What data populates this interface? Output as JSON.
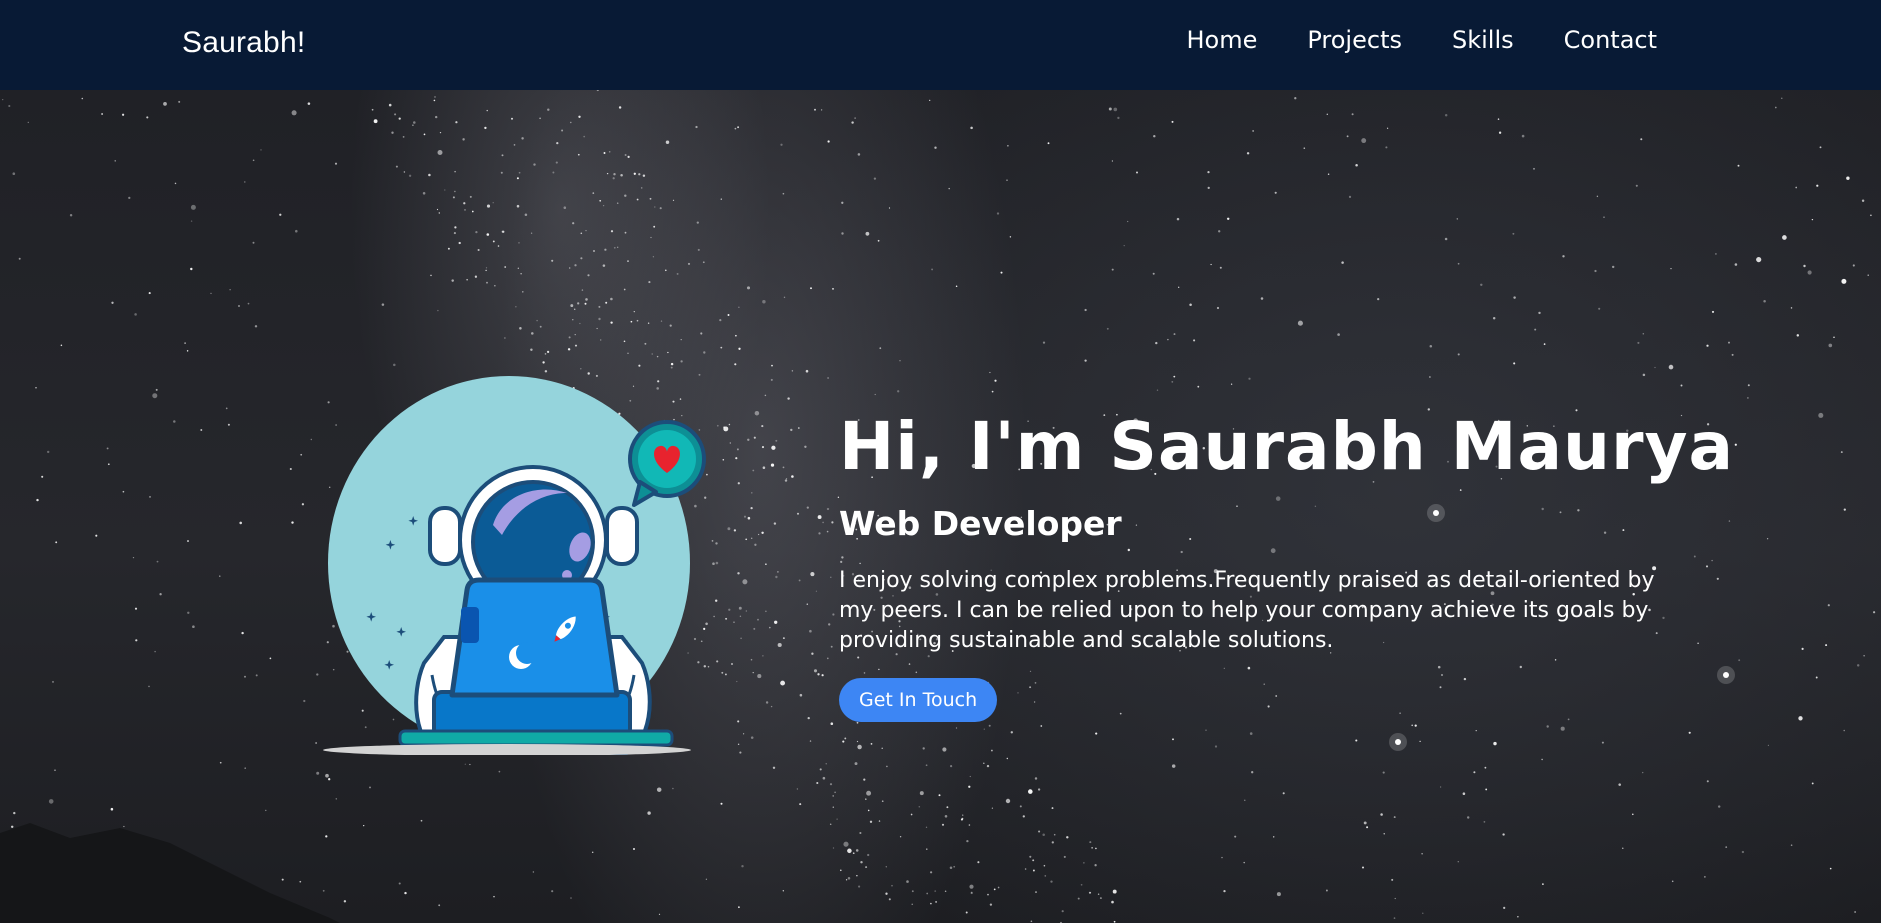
{
  "navbar": {
    "brand": "Saurabh!",
    "links": [
      {
        "label": "Home"
      },
      {
        "label": "Projects"
      },
      {
        "label": "Skills"
      },
      {
        "label": "Contact"
      }
    ]
  },
  "hero": {
    "title": "Hi, I'm Saurabh Maurya",
    "subtitle": "Web Developer",
    "description": "I enjoy solving complex problems.Frequently praised as detail-oriented by my peers. I can be relied upon to help your company achieve its goals by providing sustainable and scalable solutions.",
    "cta_label": "Get In Touch",
    "illustration": "astronaut-with-laptop-illustration"
  },
  "colors": {
    "navbar_bg": "#081a35",
    "button_bg": "#3d86f4",
    "text": "#ffffff",
    "circle_bg": "#95d4dc"
  }
}
